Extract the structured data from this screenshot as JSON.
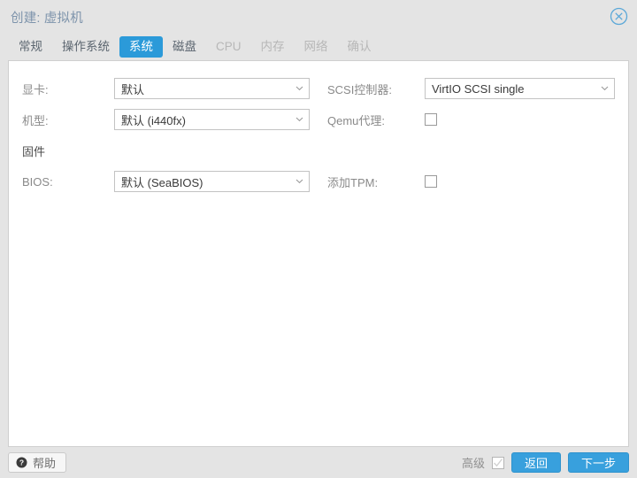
{
  "window": {
    "title": "创建: 虚拟机",
    "close_icon": "close-circle-icon"
  },
  "tabs": [
    {
      "label": "常规",
      "state": "normal"
    },
    {
      "label": "操作系统",
      "state": "normal"
    },
    {
      "label": "系统",
      "state": "active"
    },
    {
      "label": "磁盘",
      "state": "normal"
    },
    {
      "label": "CPU",
      "state": "disabled"
    },
    {
      "label": "内存",
      "state": "disabled"
    },
    {
      "label": "网络",
      "state": "disabled"
    },
    {
      "label": "确认",
      "state": "disabled"
    }
  ],
  "form": {
    "left": {
      "graphic_card": {
        "label": "显卡:",
        "value": "默认"
      },
      "machine": {
        "label": "机型:",
        "value": "默认 (i440fx)"
      },
      "firmware": {
        "label": "固件"
      },
      "bios": {
        "label": "BIOS:",
        "value": "默认 (SeaBIOS)"
      }
    },
    "right": {
      "scsi_controller": {
        "label": "SCSI控制器:",
        "value": "VirtIO SCSI single"
      },
      "qemu_agent": {
        "label": "Qemu代理:",
        "checked": false
      },
      "add_tpm": {
        "label": "添加TPM:",
        "checked": false
      }
    }
  },
  "footer": {
    "help_label": "帮助",
    "help_icon": "question-mark-icon",
    "advanced_label": "高级",
    "advanced_checked": false,
    "back_label": "返回",
    "next_label": "下一步"
  },
  "colors": {
    "accent": "#2b9ad9",
    "button": "#38a0dd",
    "title_text": "#7d93ab",
    "window_bg": "#e4e4e4",
    "panel_bg": "#ffffff",
    "label_text": "#8a8a8a",
    "disabled_tab": "#b7b7b7"
  }
}
